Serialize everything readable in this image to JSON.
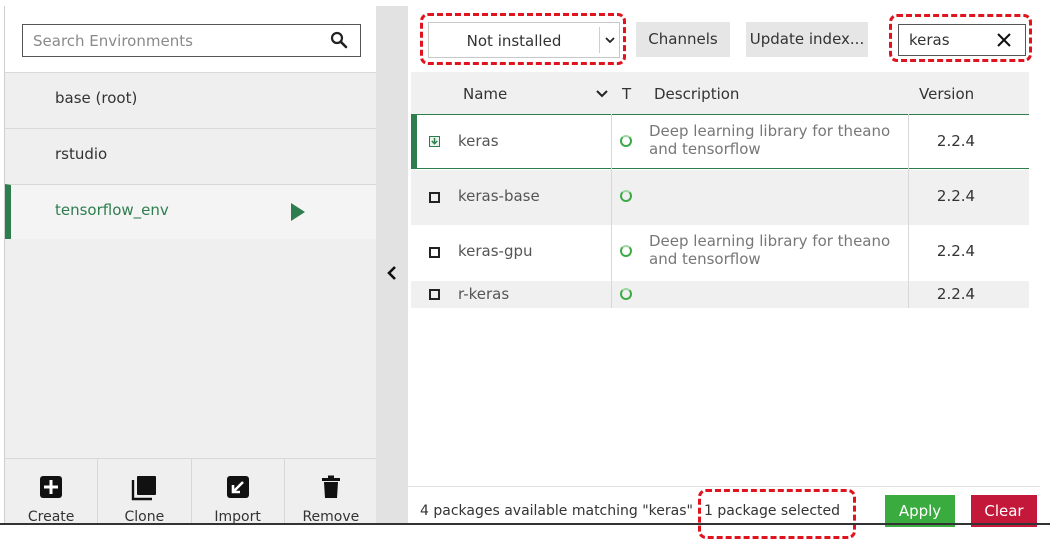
{
  "environments": {
    "search_placeholder": "Search Environments",
    "items": [
      {
        "label": "base (root)",
        "active": false
      },
      {
        "label": "rstudio",
        "active": false
      },
      {
        "label": "tensorflow_env",
        "active": true
      }
    ],
    "actions": [
      {
        "label": "Create",
        "icon": "plus-square-icon"
      },
      {
        "label": "Clone",
        "icon": "clone-icon"
      },
      {
        "label": "Import",
        "icon": "import-icon"
      },
      {
        "label": "Remove",
        "icon": "trash-icon"
      }
    ]
  },
  "toolbar": {
    "filter_value": "Not installed",
    "channels_label": "Channels",
    "update_label": "Update index...",
    "search_value": "keras"
  },
  "table": {
    "headers": {
      "name": "Name",
      "type": "T",
      "description": "Description",
      "version": "Version"
    },
    "rows": [
      {
        "name": "keras",
        "description": "Deep learning library for theano and tensorflow",
        "version": "2.2.4",
        "selected": true
      },
      {
        "name": "keras-base",
        "description": "",
        "version": "2.2.4",
        "selected": false
      },
      {
        "name": "keras-gpu",
        "description": "Deep learning library for theano and tensorflow",
        "version": "2.2.4",
        "selected": false
      },
      {
        "name": "r-keras",
        "description": "",
        "version": "2.2.4",
        "selected": false
      }
    ]
  },
  "status": {
    "count_text": "4 packages available matching \"keras\"",
    "selected_text": "1 package selected",
    "apply_label": "Apply",
    "clear_label": "Clear"
  },
  "colors": {
    "accent_green": "#2e7d4f",
    "apply_green": "#3aab3f",
    "clear_red": "#c3183a",
    "callout_red": "#e0141e"
  }
}
